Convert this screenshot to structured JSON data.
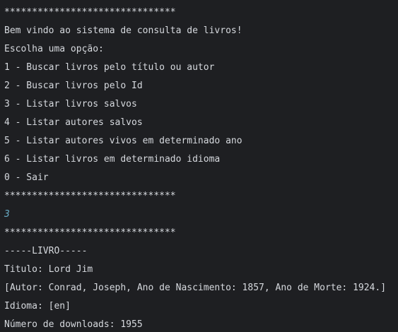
{
  "console": {
    "colors": {
      "background": "#1e1f22",
      "text": "#d6d9de",
      "user_input": "#6aaec8"
    },
    "lines": [
      {
        "text": "*******************************",
        "kind": "separator"
      },
      {
        "text": "Bem vindo ao sistema de consulta de livros!",
        "kind": "output"
      },
      {
        "text": "Escolha uma opção:",
        "kind": "output"
      },
      {
        "text": "1 - Buscar livros pelo título ou autor",
        "kind": "menu-option"
      },
      {
        "text": "2 - Buscar livros pelo Id",
        "kind": "menu-option"
      },
      {
        "text": "3 - Listar livros salvos",
        "kind": "menu-option"
      },
      {
        "text": "4 - Listar autores salvos",
        "kind": "menu-option"
      },
      {
        "text": "5 - Listar autores vivos em determinado ano",
        "kind": "menu-option"
      },
      {
        "text": "6 - Listar livros em determinado idioma",
        "kind": "menu-option"
      },
      {
        "text": "0 - Sair",
        "kind": "menu-option"
      },
      {
        "text": "*******************************",
        "kind": "separator"
      },
      {
        "text": "3",
        "kind": "input"
      },
      {
        "text": "*******************************",
        "kind": "separator"
      },
      {
        "text": "-----LIVRO-----",
        "kind": "output"
      },
      {
        "text": "Titulo: Lord Jim",
        "kind": "output"
      },
      {
        "text": "[Autor: Conrad, Joseph, Ano de Nascimento: 1857, Ano de Morte: 1924.]",
        "kind": "output"
      },
      {
        "text": "Idioma: [en]",
        "kind": "output"
      },
      {
        "text": "Número de downloads: 1955",
        "kind": "output"
      }
    ]
  }
}
